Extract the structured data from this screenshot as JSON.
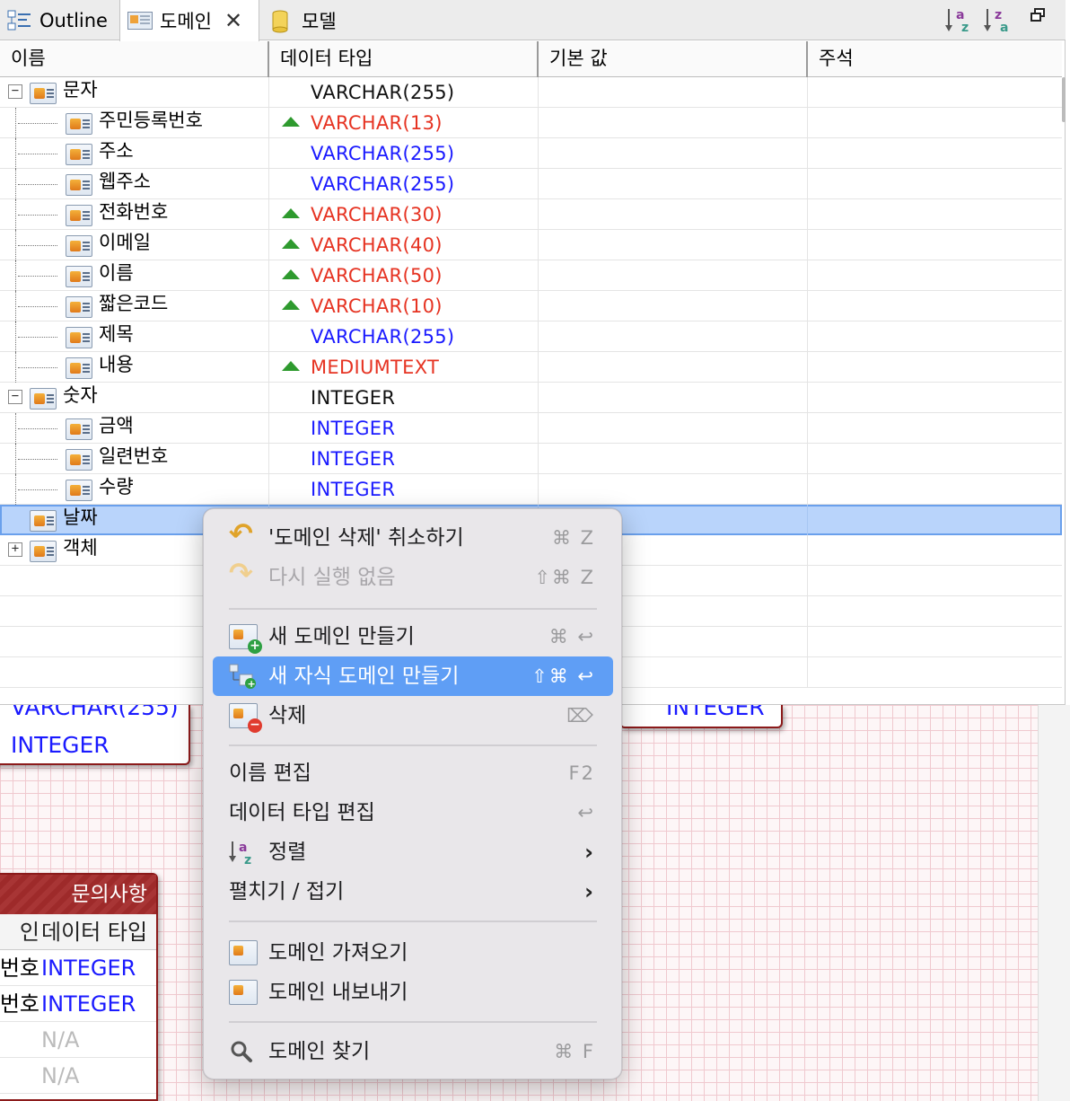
{
  "tabs": {
    "outline": "Outline",
    "domain": "도메인",
    "model": "모델"
  },
  "toolbar": {
    "sort_asc_icon": "sort-az-icon",
    "sort_desc_icon": "sort-za-icon",
    "restore_icon": "restore-window-icon"
  },
  "columns": [
    "이름",
    "데이터 타입",
    "기본 값",
    "주석"
  ],
  "tree": [
    {
      "name": "문자",
      "type": "VARCHAR(255)",
      "color": "black",
      "level": 0,
      "expander": "−",
      "changed": false
    },
    {
      "name": "주민등록번호",
      "type": "VARCHAR(13)",
      "color": "red",
      "level": 1,
      "changed": true
    },
    {
      "name": "주소",
      "type": "VARCHAR(255)",
      "color": "blue",
      "level": 1,
      "changed": false
    },
    {
      "name": "웹주소",
      "type": "VARCHAR(255)",
      "color": "blue",
      "level": 1,
      "changed": false
    },
    {
      "name": "전화번호",
      "type": "VARCHAR(30)",
      "color": "red",
      "level": 1,
      "changed": true
    },
    {
      "name": "이메일",
      "type": "VARCHAR(40)",
      "color": "red",
      "level": 1,
      "changed": true
    },
    {
      "name": "이름",
      "type": "VARCHAR(50)",
      "color": "red",
      "level": 1,
      "changed": true
    },
    {
      "name": "짧은코드",
      "type": "VARCHAR(10)",
      "color": "red",
      "level": 1,
      "changed": true
    },
    {
      "name": "제목",
      "type": "VARCHAR(255)",
      "color": "blue",
      "level": 1,
      "changed": false
    },
    {
      "name": "내용",
      "type": "MEDIUMTEXT",
      "color": "red",
      "level": 1,
      "changed": true
    },
    {
      "name": "숫자",
      "type": "INTEGER",
      "color": "black",
      "level": 0,
      "expander": "−",
      "changed": false
    },
    {
      "name": "금액",
      "type": "INTEGER",
      "color": "blue",
      "level": 1,
      "changed": false
    },
    {
      "name": "일련번호",
      "type": "INTEGER",
      "color": "blue",
      "level": 1,
      "changed": false
    },
    {
      "name": "수량",
      "type": "INTEGER",
      "color": "blue",
      "level": 1,
      "changed": false
    },
    {
      "name": "날짜",
      "type": "",
      "color": "black",
      "level": 0,
      "expander": "",
      "changed": false,
      "selected": true
    },
    {
      "name": "객체",
      "type": "",
      "color": "black",
      "level": 0,
      "expander": "+",
      "changed": false
    }
  ],
  "context_menu": {
    "undo": {
      "label": "'도메인 삭제' 취소하기",
      "shortcut": "⌘ Z"
    },
    "redo": {
      "label": "다시 실행 없음",
      "shortcut": "⇧⌘ Z"
    },
    "new_domain": {
      "label": "새 도메인 만들기",
      "shortcut": "⌘ ↩"
    },
    "new_child_domain": {
      "label": "새 자식 도메인 만들기",
      "shortcut": "⇧⌘ ↩"
    },
    "delete": {
      "label": "삭제",
      "shortcut": "⌦"
    },
    "rename": {
      "label": "이름 편집",
      "shortcut": "F2"
    },
    "edit_type": {
      "label": "데이터 타입 편집",
      "shortcut": "↩"
    },
    "sort": {
      "label": "정렬"
    },
    "expand_collapse": {
      "label": "펼치기 / 접기"
    },
    "import": {
      "label": "도메인 가져오기"
    },
    "export": {
      "label": "도메인 내보내기"
    },
    "find": {
      "label": "도메인 찾기",
      "shortcut": "⌘ F"
    }
  },
  "diagram": {
    "left_entity_value": "INTEGER",
    "left_entity_partial": "VARCHAR(255)",
    "right_entity_partial": "INTEGER",
    "bottom_entity": {
      "title": "문의사항",
      "col_left": "인",
      "col_right": "데이터 타입",
      "rows": [
        {
          "left": "번호",
          "right": "INTEGER",
          "style": "blue"
        },
        {
          "left": "번호",
          "right": "INTEGER",
          "style": "blue"
        },
        {
          "left": "",
          "right": "N/A",
          "style": "gray"
        },
        {
          "left": "",
          "right": "N/A",
          "style": "gray"
        }
      ]
    }
  }
}
